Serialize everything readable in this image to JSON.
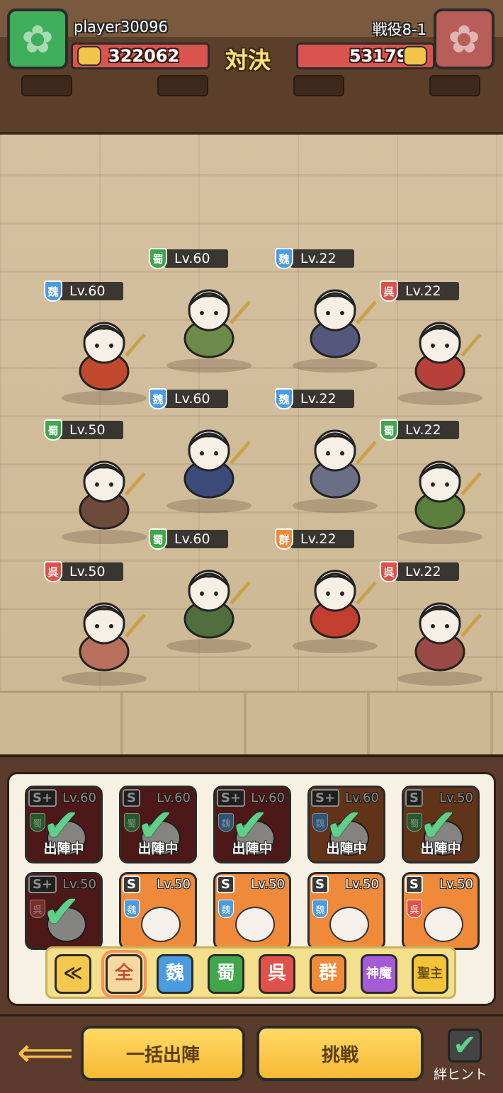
{
  "hud": {
    "player_name": "player30096",
    "player_power": "322062",
    "versus_label": "対決",
    "stage_name": "戦役8-1",
    "enemy_power": "53179"
  },
  "colors": {
    "wei": "#4b9be0",
    "shu": "#3fa64a",
    "wu": "#e0514b",
    "qun": "#ef8a3b",
    "shenmo": "#a55ad6",
    "shengzhu": "#f1c537"
  },
  "units": [
    {
      "faction": "魏",
      "level": "Lv.60",
      "color": "#c0492e"
    },
    {
      "faction": "蜀",
      "level": "Lv.60",
      "color": "#6e8a4a"
    },
    {
      "faction": "魏",
      "level": "Lv.22",
      "color": "#56577d"
    },
    {
      "faction": "呉",
      "level": "Lv.22",
      "color": "#b8403b"
    },
    {
      "faction": "魏",
      "level": "Lv.60",
      "color": "#3d4b7a"
    },
    {
      "faction": "魏",
      "level": "Lv.22",
      "color": "#6b6f86"
    },
    {
      "faction": "蜀",
      "level": "Lv.50",
      "color": "#6e4a3a"
    },
    {
      "faction": "蜀",
      "level": "Lv.22",
      "color": "#5b7e3c"
    },
    {
      "faction": "蜀",
      "level": "Lv.60",
      "color": "#4f6d3d"
    },
    {
      "faction": "群",
      "level": "Lv.22",
      "color": "#c43e2f"
    },
    {
      "faction": "呉",
      "level": "Lv.50",
      "color": "#b8705d"
    },
    {
      "faction": "呉",
      "level": "Lv.22",
      "color": "#9a4a45"
    }
  ],
  "roster": [
    {
      "rank": "S+",
      "level": "Lv.60",
      "faction": "蜀",
      "deployed": "出陣中",
      "bg": "#8a2e2c",
      "selected": true
    },
    {
      "rank": "S",
      "level": "Lv.60",
      "faction": "蜀",
      "deployed": "出陣中",
      "bg": "#8a2e2c",
      "selected": true
    },
    {
      "rank": "S+",
      "level": "Lv.60",
      "faction": "魏",
      "deployed": "出陣中",
      "bg": "#8a2e2c",
      "selected": true
    },
    {
      "rank": "S+",
      "level": "Lv.60",
      "faction": "魏",
      "deployed": "出陣中",
      "bg": "#b1602e",
      "selected": true
    },
    {
      "rank": "S",
      "level": "Lv.50",
      "faction": "蜀",
      "deployed": "出陣中",
      "bg": "#b1602e",
      "selected": true
    },
    {
      "rank": "S+",
      "level": "Lv.50",
      "faction": "呉",
      "deployed": "",
      "bg": "#8a2e2c",
      "selected": true
    },
    {
      "rank": "S",
      "level": "Lv.50",
      "faction": "魏",
      "deployed": "",
      "bg": "#ef8a3b",
      "selected": false
    },
    {
      "rank": "S",
      "level": "Lv.50",
      "faction": "魏",
      "deployed": "",
      "bg": "#ef8a3b",
      "selected": false
    },
    {
      "rank": "S",
      "level": "Lv.50",
      "faction": "魏",
      "deployed": "",
      "bg": "#ef8a3b",
      "selected": false
    },
    {
      "rank": "S",
      "level": "Lv.50",
      "faction": "呉",
      "deployed": "",
      "bg": "#ef8a3b",
      "selected": false
    }
  ],
  "filters": [
    {
      "label": "≪",
      "icon": "collapse-chevron-icon"
    },
    {
      "label": "全"
    },
    {
      "label": "魏"
    },
    {
      "label": "蜀"
    },
    {
      "label": "呉"
    },
    {
      "label": "群"
    },
    {
      "label": "神魔"
    },
    {
      "label": "聖主"
    }
  ],
  "actions": {
    "auto_deploy_label": "一括出陣",
    "challenge_label": "挑戦",
    "bond_hint_label": "絆ヒント",
    "back_icon": "back-arrow-icon"
  }
}
